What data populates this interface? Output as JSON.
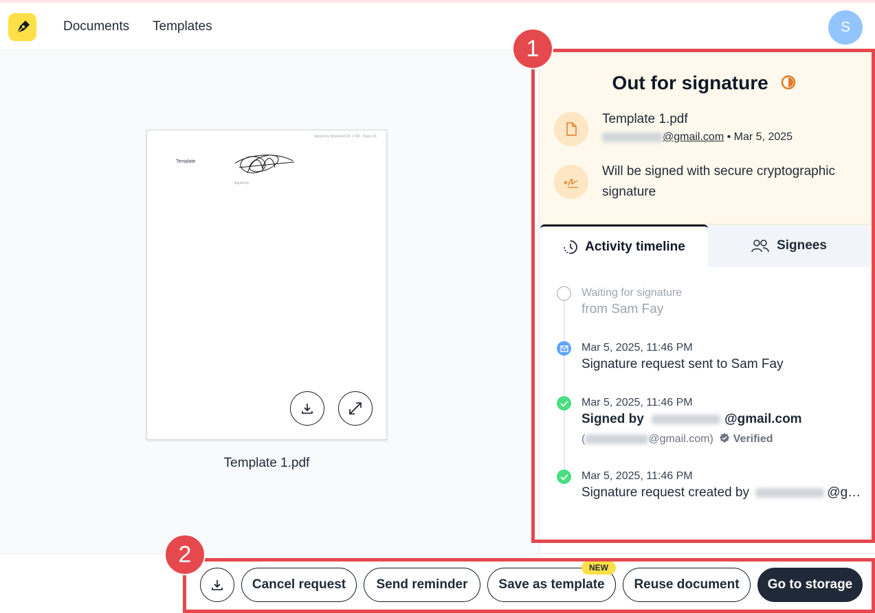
{
  "header": {
    "nav": [
      "Documents",
      "Templates"
    ],
    "avatar_initial": "S"
  },
  "preview": {
    "doc_name": "Template 1.pdf",
    "page_header": "Signed by Document ID: 1740 · Page 1/1",
    "template_label": "Template",
    "signature_caption": "Signed by"
  },
  "summary": {
    "status": "Out for signature",
    "file_name": "Template 1.pdf",
    "email_suffix": "@gmail.com",
    "date": " • Mar 5, 2025",
    "signature_note": "Will be signed with secure cryptographic signature"
  },
  "tabs": {
    "activity": "Activity timeline",
    "signees": "Signees"
  },
  "timeline": [
    {
      "line1": "Waiting for signature",
      "line2": "from Sam Fay"
    },
    {
      "date": "Mar 5, 2025, 11:46 PM",
      "text": "Signature request sent to Sam Fay"
    },
    {
      "date": "Mar 5, 2025, 11:46 PM",
      "signed_by": "Signed by",
      "email_suffix": "@gmail.com",
      "sub_email": "@gmail.com)",
      "verified": "Verified"
    },
    {
      "date": "Mar 5, 2025, 11:46 PM",
      "text": "Signature request created by",
      "truncated": "@g…"
    }
  ],
  "actions": {
    "cancel": "Cancel request",
    "reminder": "Send reminder",
    "save_template": "Save as template",
    "new_badge": "NEW",
    "reuse": "Reuse document",
    "storage": "Go to storage"
  },
  "annotations": {
    "one": "1",
    "two": "2"
  },
  "colors": {
    "accent_red": "#e5484d",
    "brand_yellow": "#fde047",
    "summary_bg": "#fef9ec",
    "status_orange": "#e07b24",
    "success_green": "#4ade80",
    "info_blue": "#60a5fa"
  }
}
